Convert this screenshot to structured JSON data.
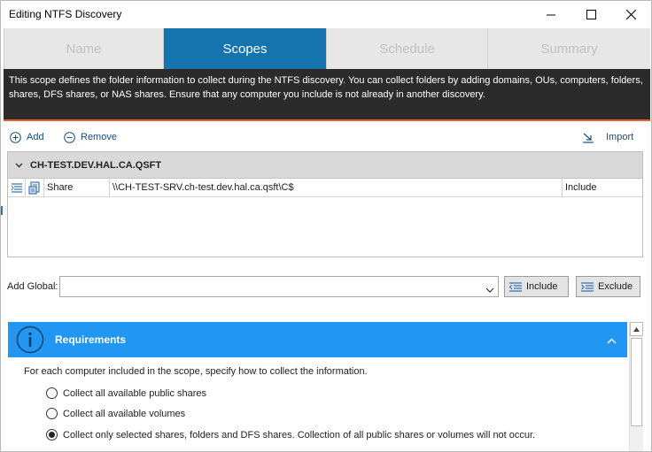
{
  "window": {
    "title": "Editing NTFS Discovery"
  },
  "tabs": [
    {
      "label": "Name",
      "active": false
    },
    {
      "label": "Scopes",
      "active": true
    },
    {
      "label": "Schedule",
      "active": false
    },
    {
      "label": "Summary",
      "active": false
    }
  ],
  "description": "This scope defines the folder information to collect during the NTFS discovery.  You can collect folders by adding domains, OUs, computers, folders, shares, DFS shares, or NAS shares.  Ensure that any computer you include is not already in another discovery.",
  "actions": {
    "add_label": "Add",
    "remove_label": "Remove",
    "import_label": "Import"
  },
  "scope_list": {
    "group_title": "CH-TEST.DEV.HAL.CA.QSFT",
    "rows": [
      {
        "type": "Share",
        "path": "\\\\CH-TEST-SRV.ch-test.dev.hal.ca.qsft\\C$",
        "action": "Include"
      }
    ]
  },
  "add_global": {
    "label": "Add Global:",
    "value": "",
    "include_label": "Include",
    "exclude_label": "Exclude"
  },
  "requirements": {
    "title": "Requirements",
    "text": "For each computer included in the scope, specify how to collect the information.",
    "options": [
      {
        "label": "Collect all available public shares",
        "selected": false
      },
      {
        "label": "Collect all available volumes",
        "selected": false
      },
      {
        "label": "Collect only selected shares, folders and DFS shares.  Collection of all public shares or volumes will not occur.",
        "selected": true
      }
    ]
  },
  "colors": {
    "active_tab": "#1573ad",
    "description_bg": "#2b2b2b",
    "accent_line": "#e2602b",
    "requirements_header": "#2196f3",
    "link": "#1a4f7a"
  },
  "icons": {
    "add": "plus-circle-icon",
    "remove": "minus-circle-icon",
    "import": "import-arrow-icon",
    "group_toggle": "chevron-down-icon",
    "info": "info-circle-icon",
    "collapse": "chevron-up-icon"
  }
}
